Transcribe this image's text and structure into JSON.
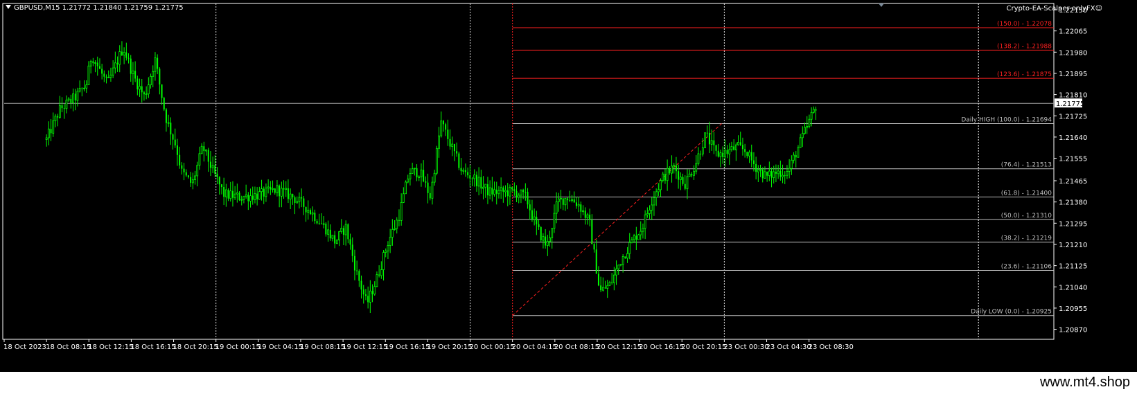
{
  "header": {
    "symbol_line": "GBPUSD,M15  1.21772 1.21840 1.21759 1.21775",
    "ea_label": "Crypto-EA-Scalper-onlyFX"
  },
  "watermark": "www.mt4.shop",
  "colors": {
    "background": "#000000",
    "candle": "#00ff00",
    "grid": "#c8c8c8",
    "fib_ext": "#ff2020",
    "fib_level": "#bfbfbf",
    "axis_text": "#ffffff"
  },
  "chart_data": {
    "type": "candlestick",
    "symbol": "GBPUSD",
    "timeframe": "M15",
    "last_price": "1.21775",
    "ylim": [
      1.2083,
      1.22175
    ],
    "y_ticks": [
      "1.22150",
      "1.22065",
      "1.21980",
      "1.21895",
      "1.21810",
      "1.21725",
      "1.21640",
      "1.21555",
      "1.21465",
      "1.21380",
      "1.21295",
      "1.21210",
      "1.21125",
      "1.21040",
      "1.20955",
      "1.20870"
    ],
    "x_ticks": [
      "18 Oct 2023",
      "18 Oct 08:15",
      "18 Oct 12:15",
      "18 Oct 16:15",
      "18 Oct 20:15",
      "19 Oct 00:15",
      "19 Oct 04:15",
      "19 Oct 08:15",
      "19 Oct 12:15",
      "19 Oct 16:15",
      "19 Oct 20:15",
      "20 Oct 00:15",
      "20 Oct 04:15",
      "20 Oct 08:15",
      "20 Oct 12:15",
      "20 Oct 16:15",
      "20 Oct 20:15",
      "23 Oct 00:30",
      "23 Oct 04:30",
      "23 Oct 08:30"
    ],
    "day_separators": [
      "19 Oct 2023",
      "20 Oct 2023",
      "23 Oct 2023"
    ],
    "price_path": [
      [
        "18 Oct 04:15",
        1.2163
      ],
      [
        "18 Oct 05:30",
        1.2175
      ],
      [
        "18 Oct 07:00",
        1.218
      ],
      [
        "18 Oct 08:00",
        1.2185
      ],
      [
        "18 Oct 08:30",
        1.2197
      ],
      [
        "18 Oct 10:00",
        1.2185
      ],
      [
        "18 Oct 11:30",
        1.22
      ],
      [
        "18 Oct 12:30",
        1.2188
      ],
      [
        "18 Oct 13:30",
        1.218
      ],
      [
        "18 Oct 14:30",
        1.2195
      ],
      [
        "18 Oct 15:30",
        1.2172
      ],
      [
        "18 Oct 16:30",
        1.216
      ],
      [
        "18 Oct 17:00",
        1.215
      ],
      [
        "18 Oct 18:00",
        1.2145
      ],
      [
        "18 Oct 19:00",
        1.216
      ],
      [
        "18 Oct 20:00",
        1.215
      ],
      [
        "18 Oct 21:00",
        1.2141
      ],
      [
        "18 Oct 22:30",
        1.214
      ],
      [
        "19 Oct 00:30",
        1.2141
      ],
      [
        "19 Oct 02:00",
        1.2143
      ],
      [
        "19 Oct 03:30",
        1.214
      ],
      [
        "19 Oct 05:00",
        1.2135
      ],
      [
        "19 Oct 06:30",
        1.2128
      ],
      [
        "19 Oct 07:30",
        1.2122
      ],
      [
        "19 Oct 08:30",
        1.2128
      ],
      [
        "19 Oct 09:30",
        1.211
      ],
      [
        "19 Oct 10:30",
        1.2097
      ],
      [
        "19 Oct 11:30",
        1.2108
      ],
      [
        "19 Oct 12:30",
        1.2122
      ],
      [
        "19 Oct 13:30",
        1.2132
      ],
      [
        "19 Oct 14:30",
        1.215
      ],
      [
        "19 Oct 15:30",
        1.215
      ],
      [
        "19 Oct 16:30",
        1.214
      ],
      [
        "19 Oct 17:30",
        1.217
      ],
      [
        "19 Oct 18:30",
        1.216
      ],
      [
        "19 Oct 19:30",
        1.215
      ],
      [
        "19 Oct 20:30",
        1.2148
      ],
      [
        "19 Oct 22:00",
        1.2142
      ],
      [
        "20 Oct 00:30",
        1.2142
      ],
      [
        "20 Oct 01:30",
        1.214
      ],
      [
        "20 Oct 02:30",
        1.2128
      ],
      [
        "20 Oct 03:30",
        1.212
      ],
      [
        "20 Oct 04:30",
        1.2138
      ],
      [
        "20 Oct 05:30",
        1.214
      ],
      [
        "20 Oct 06:30",
        1.2137
      ],
      [
        "20 Oct 07:30",
        1.213
      ],
      [
        "20 Oct 08:30",
        1.2102
      ],
      [
        "20 Oct 09:30",
        1.2105
      ],
      [
        "20 Oct 10:30",
        1.2115
      ],
      [
        "20 Oct 11:30",
        1.2122
      ],
      [
        "20 Oct 12:30",
        1.2128
      ],
      [
        "20 Oct 13:30",
        1.214
      ],
      [
        "20 Oct 14:30",
        1.2148
      ],
      [
        "20 Oct 15:30",
        1.2152
      ],
      [
        "20 Oct 16:30",
        1.2145
      ],
      [
        "20 Oct 17:30",
        1.2153
      ],
      [
        "20 Oct 18:30",
        1.2165
      ],
      [
        "20 Oct 19:30",
        1.2157
      ],
      [
        "20 Oct 20:30",
        1.2158
      ],
      [
        "20 Oct 21:30",
        1.216
      ],
      [
        "20 Oct 22:30",
        1.2158
      ],
      [
        "23 Oct 00:30",
        1.216
      ],
      [
        "23 Oct 01:30",
        1.2162
      ],
      [
        "23 Oct 02:30",
        1.2158
      ],
      [
        "23 Oct 03:30",
        1.2152
      ],
      [
        "23 Oct 04:30",
        1.2148
      ],
      [
        "23 Oct 05:30",
        1.215
      ],
      [
        "23 Oct 06:30",
        1.215
      ],
      [
        "23 Oct 07:30",
        1.216
      ],
      [
        "23 Oct 08:30",
        1.217
      ],
      [
        "23 Oct 09:15",
        1.21775
      ]
    ],
    "fibonacci": {
      "start": "20 Oct 00:15",
      "end_label": "23 Oct 08:30",
      "levels": [
        {
          "label": "(150.0) -  1.22078",
          "price": 1.22078,
          "kind": "ext"
        },
        {
          "label": "(138.2) -  1.21988",
          "price": 1.21988,
          "kind": "ext"
        },
        {
          "label": "(123.6) -  1.21875",
          "price": 1.21875,
          "kind": "ext"
        },
        {
          "label": "Daily HIGH (100.0) -  1.21694",
          "price": 1.21694,
          "kind": "level"
        },
        {
          "label": "(76.4) -  1.21513",
          "price": 1.21513,
          "kind": "level"
        },
        {
          "label": "(61.8) -  1.21400",
          "price": 1.214,
          "kind": "level"
        },
        {
          "label": "(50.0) -  1.21310",
          "price": 1.2131,
          "kind": "level"
        },
        {
          "label": "(38.2) -  1.21219",
          "price": 1.21219,
          "kind": "level"
        },
        {
          "label": "(23.6) -  1.21106",
          "price": 1.21106,
          "kind": "level"
        },
        {
          "label": "Daily LOW (0.0) -  1.20925",
          "price": 1.20925,
          "kind": "level"
        }
      ]
    },
    "trendline": {
      "from": [
        "20 Oct 00:15",
        1.20925
      ],
      "to": [
        "20 Oct 20:00",
        1.21694
      ]
    }
  }
}
